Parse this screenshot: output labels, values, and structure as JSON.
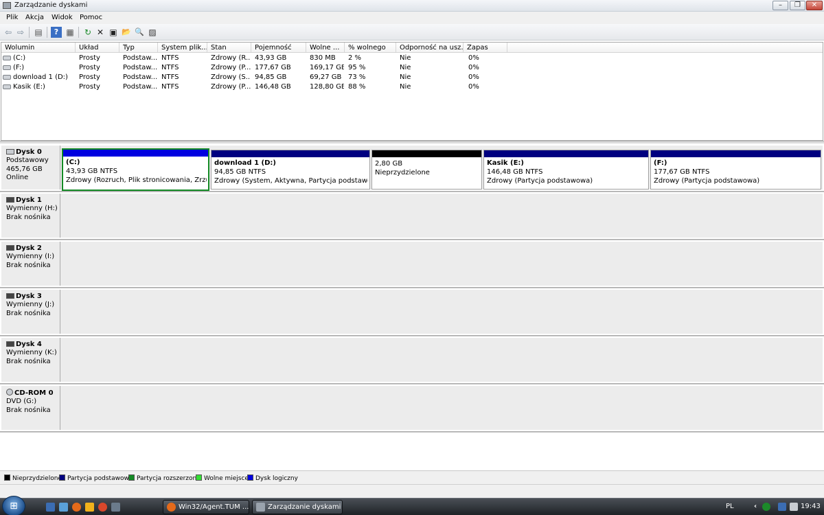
{
  "window": {
    "title": "Zarządzanie dyskami",
    "minimize_glyph": "–",
    "restore_glyph": "❐",
    "close_glyph": "✕"
  },
  "menu": [
    "Plik",
    "Akcja",
    "Widok",
    "Pomoc"
  ],
  "toolbar": {
    "back_glyph": "⇦",
    "forward_glyph": "⇨",
    "up_glyph": "▤",
    "help_glyph": "?",
    "view_glyph": "▦",
    "refresh_glyph": "↻",
    "delete_glyph": "✕",
    "properties_glyph": "▣",
    "open_glyph": "📂",
    "search_glyph": "🔍",
    "settings_glyph": "▨"
  },
  "volume_list": {
    "columns": [
      "Wolumin",
      "Układ",
      "Typ",
      "System plik...",
      "Stan",
      "Pojemność",
      "Wolne ...",
      "% wolnego",
      "Odporność na usz...",
      "Zapas"
    ],
    "rows": [
      [
        "(C:)",
        "Prosty",
        "Podstaw...",
        "NTFS",
        "Zdrowy (R...",
        "43,93 GB",
        "830 MB",
        "2 %",
        "Nie",
        "0%"
      ],
      [
        "(F:)",
        "Prosty",
        "Podstaw...",
        "NTFS",
        "Zdrowy (P...",
        "177,67 GB",
        "169,17 GB",
        "95 %",
        "Nie",
        "0%"
      ],
      [
        "download 1 (D:)",
        "Prosty",
        "Podstaw...",
        "NTFS",
        "Zdrowy (S...",
        "94,85 GB",
        "69,27 GB",
        "73 %",
        "Nie",
        "0%"
      ],
      [
        "Kasik (E:)",
        "Prosty",
        "Podstaw...",
        "NTFS",
        "Zdrowy (P...",
        "146,48 GB",
        "128,80 GB",
        "88 %",
        "Nie",
        "0%"
      ]
    ]
  },
  "disks": [
    {
      "name": "Dysk 0",
      "lines": [
        "Podstawowy",
        "465,76 GB",
        "Online"
      ],
      "partitions": [
        {
          "title": "(C:)",
          "size": "43,93 GB NTFS",
          "status": "Zdrowy (Rozruch, Plik stronicowania, Zrzut av",
          "bar_color": "#0000e0",
          "selected": true
        },
        {
          "title": "download 1  (D:)",
          "size": "94,85 GB NTFS",
          "status": "Zdrowy (System, Aktywna, Partycja podstawowa)",
          "bar_color": "#000080",
          "selected": false
        },
        {
          "title": "",
          "size": "2,80 GB",
          "status": "Nieprzydzielone",
          "bar_color": "#000000",
          "selected": false
        },
        {
          "title": "Kasik  (E:)",
          "size": "146,48 GB NTFS",
          "status": "Zdrowy (Partycja podstawowa)",
          "bar_color": "#000080",
          "selected": false
        },
        {
          "title": "(F:)",
          "size": "177,67 GB NTFS",
          "status": "Zdrowy (Partycja podstawowa)",
          "bar_color": "#000080",
          "selected": false
        }
      ]
    },
    {
      "name": "Dysk 1",
      "lines": [
        "Wymienny (H:)",
        "",
        "Brak nośnika"
      ]
    },
    {
      "name": "Dysk 2",
      "lines": [
        "Wymienny (I:)",
        "",
        "Brak nośnika"
      ]
    },
    {
      "name": "Dysk 3",
      "lines": [
        "Wymienny (J:)",
        "",
        "Brak nośnika"
      ]
    },
    {
      "name": "Dysk 4",
      "lines": [
        "Wymienny (K:)",
        "",
        "Brak nośnika"
      ]
    },
    {
      "name": "CD-ROM 0",
      "lines": [
        "DVD (G:)",
        "",
        "Brak nośnika"
      ]
    }
  ],
  "legend": [
    {
      "label": "Nieprzydzielone",
      "color": "#000000"
    },
    {
      "label": "Partycja podstawowa",
      "color": "#000080"
    },
    {
      "label": "Partycja rozszerzona",
      "color": "#138a24"
    },
    {
      "label": "Wolne miejsce",
      "color": "#33dd33"
    },
    {
      "label": "Dysk logiczny",
      "color": "#0000e0"
    }
  ],
  "taskbar": {
    "start_glyph": "⊞",
    "tasks": [
      {
        "label": "Win32/Agent.TUM ...",
        "icon_color": "#e56a1a"
      },
      {
        "label": "Zarządzanie dyskami",
        "icon_color": "#9aa3ad"
      }
    ],
    "language": "PL",
    "tray_arrow": "‹",
    "clock": "19:43"
  }
}
